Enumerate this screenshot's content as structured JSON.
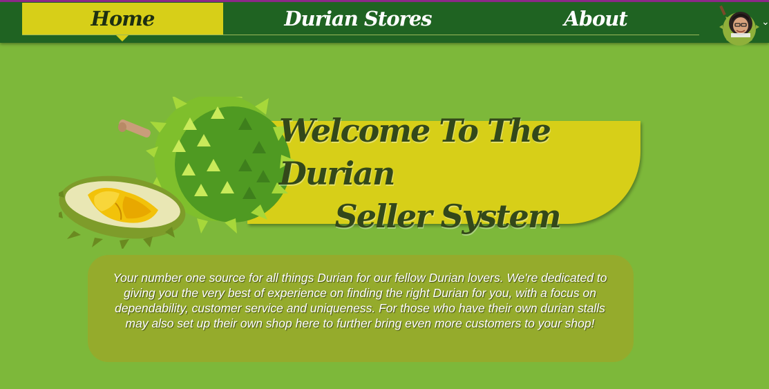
{
  "nav": {
    "items": [
      {
        "label": "Home",
        "active": true
      },
      {
        "label": "Durian Stores",
        "active": false
      },
      {
        "label": "About",
        "active": false
      }
    ],
    "profile_icon": "user-avatar",
    "menu_icon": "chevron-down-icon"
  },
  "hero": {
    "title_line1": "Welcome To The Durian",
    "title_line2": "Seller System"
  },
  "intro": {
    "text": "Your number one source for all things Durian for our fellow Durian lovers. We're dedicated to giving you the very best of experience on finding the right Durian for you, with a focus on dependability, customer service and uniqueness. For those who have their own durian stalls may also set up their own shop here to further bring even more customers to your shop!"
  },
  "colors": {
    "page_bg": "#7db83a",
    "nav_bg": "#1f6322",
    "accent_yellow": "#d7cf18",
    "title_text": "#33481a",
    "info_bg": "#95ab2c",
    "top_line": "#8e2a8a"
  }
}
